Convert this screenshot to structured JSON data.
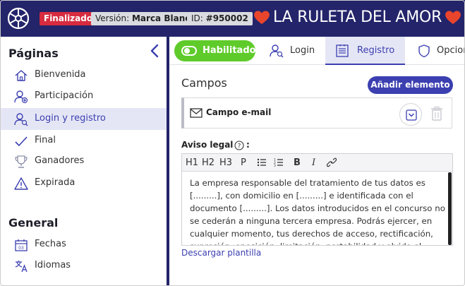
{
  "header": {
    "status_badge": "Finalizado",
    "version_prefix": "Versión: ",
    "version_value": "Marca Blanca",
    "id_prefix": "ID: ",
    "id_value": "#950002",
    "app_title": "LA RULETA DEL AMOR",
    "colors": {
      "bar": "#23246a",
      "status": "#d72b3f",
      "heart": "#e8452c"
    }
  },
  "sidebar": {
    "sections": [
      {
        "title": "Páginas",
        "items": [
          {
            "label": "Bienvenida",
            "icon": "home-icon"
          },
          {
            "label": "Participación",
            "icon": "user-add-icon"
          },
          {
            "label": "Login y registro",
            "icon": "user-search-icon",
            "active": true
          },
          {
            "label": "Final",
            "icon": "check-icon"
          },
          {
            "label": "Ganadores",
            "icon": "trophy-icon"
          },
          {
            "label": "Expirada",
            "icon": "warning-icon"
          }
        ]
      },
      {
        "title": "General",
        "items": [
          {
            "label": "Fechas",
            "icon": "calendar-icon"
          },
          {
            "label": "Idiomas",
            "icon": "translate-icon"
          }
        ]
      }
    ]
  },
  "tabs": {
    "toggle_label": "Habilitado",
    "items": [
      {
        "label": "Login",
        "icon": "user-search-icon"
      },
      {
        "label": "Registro",
        "icon": "form-icon",
        "active": true
      },
      {
        "label": "Opciones",
        "icon": "shield-icon"
      }
    ]
  },
  "main": {
    "fields_title": "Campos",
    "add_button": "Añadir elemento",
    "field_card_label": "Campo e-mail",
    "legal_label": "Aviso legal",
    "legal_colon": ":",
    "toolbar": {
      "h1": "H1",
      "h2": "H2",
      "h3": "H3",
      "p": "P",
      "bold": "B",
      "italic": "I"
    },
    "legal_text": "La empresa responsable del tratamiento de tus datos es [.........], con domicilio en [.........] e identificada con el documento [.........]. Los datos introducidos en el concurso no se cederán a ninguna tercera empresa. Podrás ejercer, en cualquier momento, tus derechos de acceso, rectificación, supresión, oposición, limitación, portabilidad y olvido el",
    "download_link": "Descargar plantilla"
  }
}
